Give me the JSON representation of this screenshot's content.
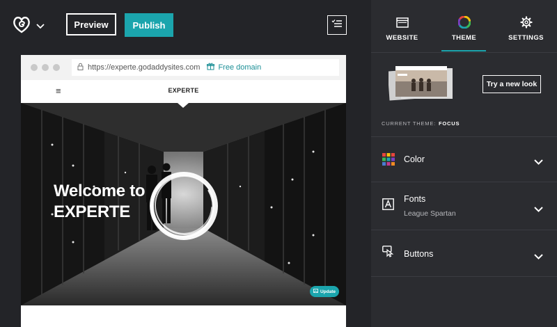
{
  "topbar": {
    "logo_icon": "godaddy-heart-logo",
    "preview_label": "Preview",
    "publish_label": "Publish",
    "checklist_icon": "checklist-icon",
    "accent_color": "#1ba5ad"
  },
  "browser": {
    "url": "https://experte.godaddysites.com",
    "free_domain_label": "Free domain",
    "site_title": "EXPERTE",
    "hero_title_line1": "Welcome to",
    "hero_title_line2": "EXPERTE",
    "update_label": "Update"
  },
  "panel": {
    "tabs": [
      {
        "label": "WEBSITE",
        "icon": "browser-window-icon"
      },
      {
        "label": "THEME",
        "icon": "color-wheel-icon",
        "active": true
      },
      {
        "label": "SETTINGS",
        "icon": "gear-icon"
      }
    ],
    "try_new_look_label": "Try a new look",
    "current_theme_label": "CURRENT THEME:",
    "current_theme_value": "FOCUS",
    "sections": [
      {
        "label": "Color",
        "icon": "color-palette-icon"
      },
      {
        "label": "Fonts",
        "sublabel": "League Spartan",
        "icon": "font-icon"
      },
      {
        "label": "Buttons",
        "icon": "button-cursor-icon"
      }
    ]
  }
}
